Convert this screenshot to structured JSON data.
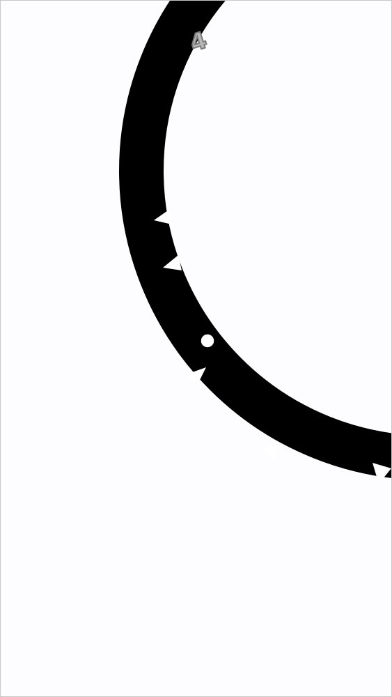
{
  "hud": {
    "score": "4"
  },
  "colors": {
    "background": "#fdfcfe",
    "ring": "#000000",
    "spike": "#ffffff",
    "ball_fill": "#ffffff",
    "ball_stroke": "#000000",
    "score_fill": "#b9b9b9",
    "score_outline": "#7a7a7a"
  },
  "game": {
    "spike_count": 6,
    "ball": "white-ball-icon"
  }
}
